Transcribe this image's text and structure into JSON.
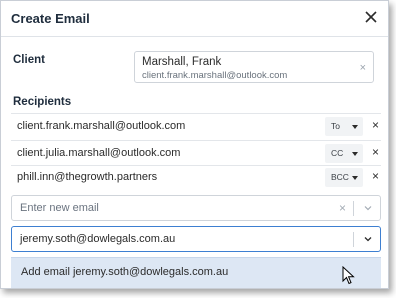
{
  "dialog": {
    "title": "Create Email",
    "close_icon": "close-icon"
  },
  "client": {
    "label": "Client",
    "name": "Marshall, Frank",
    "email": "client.frank.marshall@outlook.com",
    "clear_glyph": "×"
  },
  "recipients": {
    "label": "Recipients",
    "items": [
      {
        "email": "client.frank.marshall@outlook.com",
        "type": "To"
      },
      {
        "email": "client.julia.marshall@outlook.com",
        "type": "CC"
      },
      {
        "email": "phill.inn@thegrowth.partners",
        "type": "BCC"
      }
    ],
    "remove_glyph": "×"
  },
  "new_email": {
    "placeholder": "Enter new email",
    "clear_glyph": "×"
  },
  "search": {
    "value": "jeremy.soth@dowlegals.com.au"
  },
  "suggestion": {
    "label": "Add email jeremy.soth@dowlegals.com.au"
  },
  "colors": {
    "focus_border": "#3d7fd1",
    "suggestion_bg": "#dde7f4"
  }
}
